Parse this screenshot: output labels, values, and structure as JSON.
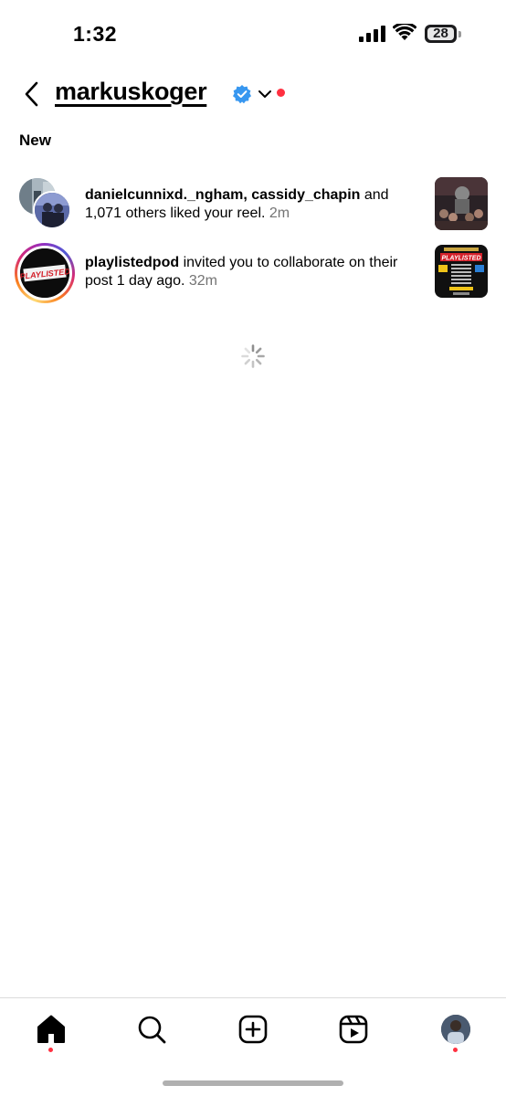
{
  "status_bar": {
    "time": "1:32",
    "battery_level": "28",
    "icons": [
      "cellular-signal-icon",
      "wifi-icon",
      "battery-icon"
    ]
  },
  "header": {
    "back_icon": "chevron-left-icon",
    "account_name": "markuskoger",
    "verified_icon": "verified-badge-icon",
    "dropdown_icon": "chevron-down-icon",
    "accent_color": "#ff3040",
    "verified_color": "#3797f0"
  },
  "section": {
    "title": "New"
  },
  "notifications": [
    {
      "users": "danielcunnixd._ngham, cassidy_chapin",
      "message": " and 1,071 others liked your reel.",
      "time": "2m",
      "thumbnail": "reel-thumbnail"
    },
    {
      "users": "playlistedpod",
      "message": " invited you to collaborate on their post 1 day ago.",
      "time": "32m",
      "avatar_text": "PLAYLISTED",
      "thumbnail_text": "PLAYLISTED",
      "thumbnail": "post-thumbnail"
    }
  ],
  "loading": {
    "icon": "loading-spinner-icon"
  },
  "tab_bar": {
    "tabs": [
      {
        "name": "home",
        "icon": "home-icon",
        "active": true,
        "badge": true
      },
      {
        "name": "search",
        "icon": "search-icon",
        "active": false,
        "badge": false
      },
      {
        "name": "create",
        "icon": "plus-square-icon",
        "active": false,
        "badge": false
      },
      {
        "name": "reels",
        "icon": "reels-icon",
        "active": false,
        "badge": false
      },
      {
        "name": "profile",
        "icon": "profile-avatar",
        "active": false,
        "badge": true
      }
    ]
  }
}
